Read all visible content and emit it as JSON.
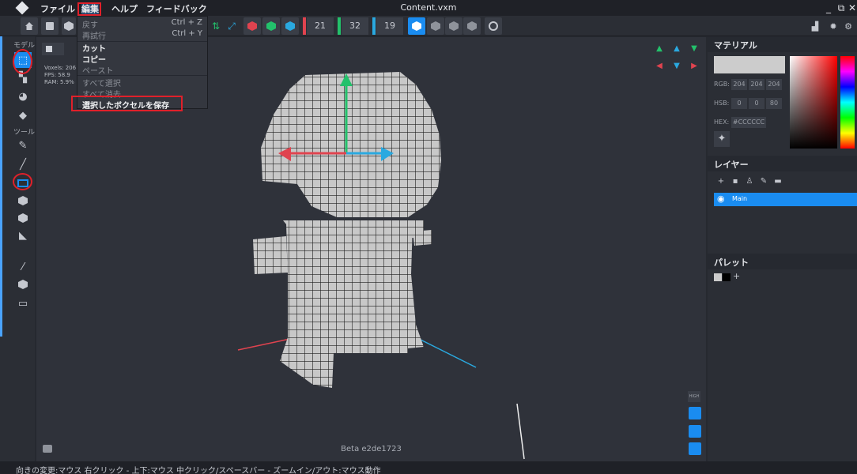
{
  "menubar": {
    "items": [
      "ファイル",
      "編集",
      "ヘルプ",
      "フィードバック"
    ],
    "title": "Content.vxm",
    "window_buttons": [
      "_",
      "⧉",
      "✕"
    ]
  },
  "edit_menu": {
    "items": [
      {
        "label": "戻す",
        "shortcut": "Ctrl + Z",
        "enabled": false
      },
      {
        "label": "再試行",
        "shortcut": "Ctrl + Y",
        "enabled": false
      },
      {
        "label": "カット",
        "shortcut": "",
        "enabled": true
      },
      {
        "label": "コピー",
        "shortcut": "",
        "enabled": true
      },
      {
        "label": "ペースト",
        "shortcut": "",
        "enabled": false
      },
      {
        "label": "すべて選択",
        "shortcut": "",
        "enabled": false
      },
      {
        "label": "すべて消去",
        "shortcut": "",
        "enabled": false
      },
      {
        "label": "選択したボクセルを保存",
        "shortcut": "",
        "enabled": true,
        "highlighted": true
      }
    ]
  },
  "toolbar": {
    "numbers": [
      "21",
      "32",
      "19"
    ],
    "colors": {
      "red": "#e0434f",
      "green": "#23c16b",
      "blue": "#2aa9e0",
      "accent": "#1a8cf0"
    }
  },
  "left_tools": {
    "section_model": "モデル",
    "section_tools": "ツール",
    "icons": [
      "select-icon",
      "layers-icon",
      "palette-icon",
      "eraser-icon",
      "pencil-icon",
      "line-icon",
      "rectangle-icon",
      "cube-icon",
      "extrude-icon",
      "fill-icon",
      "eyedropper-icon",
      "voxel-icon",
      "screen-icon"
    ]
  },
  "viewport": {
    "stats": [
      "Voxels: 206",
      "FPS: 58.9",
      "RAM: 5.9%"
    ],
    "build": "Beta e2de1723",
    "view_button": "HIGH"
  },
  "material": {
    "title": "マテリアル",
    "rgb_label": "RGB:",
    "rgb": [
      "204",
      "204",
      "204"
    ],
    "hsb_label": "HSB:",
    "hsb": [
      "0",
      "0",
      "80"
    ],
    "hex_label": "HEX:",
    "hex": "#CCCCCC",
    "swatch": "#cccccc"
  },
  "layers": {
    "title": "レイヤー",
    "items": [
      {
        "name": "Main",
        "visible": true
      }
    ]
  },
  "palette": {
    "title": "パレット",
    "add": "+"
  },
  "status": {
    "text": "向きの変更:マウス 右クリック - 上下:マウス 中クリック/スペースバー - ズームイン/アウト:マウス動作"
  }
}
